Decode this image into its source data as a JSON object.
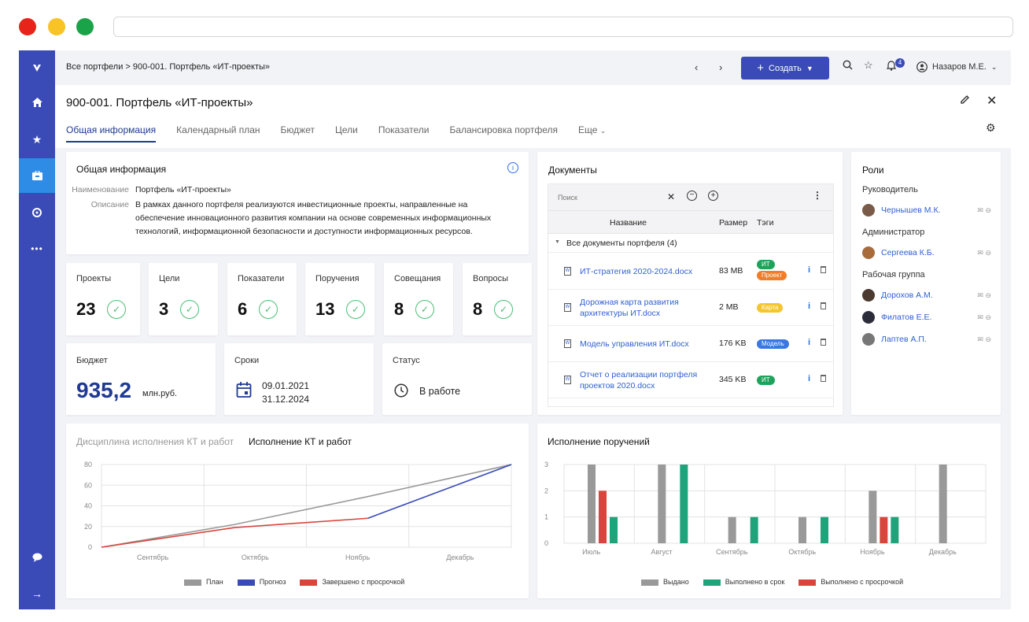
{
  "breadcrumb": "Все портфели > 900-001. Портфель «ИТ-проекты»",
  "toolbar": {
    "create_label": "Создать",
    "notifications_count": "4",
    "user_name": "Назаров М.Е."
  },
  "page": {
    "title": "900-001. Портфель «ИТ-проекты»"
  },
  "tabs": [
    {
      "label": "Общая информация",
      "active": true
    },
    {
      "label": "Календарный план"
    },
    {
      "label": "Бюджет"
    },
    {
      "label": "Цели"
    },
    {
      "label": "Показатели"
    },
    {
      "label": "Балансировка портфеля"
    },
    {
      "label": "Еще"
    }
  ],
  "general_info": {
    "title": "Общая информация",
    "name_key": "Наименование",
    "name_val": "Портфель «ИТ-проекты»",
    "desc_key": "Описание",
    "desc_val": "В рамках данного портфеля реализуются инвестиционные проекты, направленные на обеспечение инновационного развития компании на основе современных информационных технологий, информационной безопасности и доступности информационных ресурсов."
  },
  "stats": [
    {
      "label": "Проекты",
      "value": "23"
    },
    {
      "label": "Цели",
      "value": "3"
    },
    {
      "label": "Показатели",
      "value": "6"
    },
    {
      "label": "Поручения",
      "value": "13"
    },
    {
      "label": "Совещания",
      "value": "8"
    },
    {
      "label": "Вопросы",
      "value": "8"
    }
  ],
  "budget": {
    "label": "Бюджет",
    "value": "935,2",
    "unit": "млн.руб."
  },
  "terms": {
    "label": "Сроки",
    "start": "09.01.2021",
    "end": "31.12.2024"
  },
  "status": {
    "label": "Статус",
    "value": "В работе"
  },
  "documents": {
    "title": "Документы",
    "search_placeholder": "Поиск",
    "col_name": "Название",
    "col_size": "Размер",
    "col_tags": "Тэги",
    "group_label": "Все документы портфеля (4)",
    "rows": [
      {
        "name": "ИТ-стратегия 2020-2024.docx",
        "size": "83 MB",
        "tags": [
          "ИТ",
          "Проект"
        ]
      },
      {
        "name": "Дорожная карта развития архитектуры ИТ.docx",
        "size": "2 MB",
        "tags": [
          "Карта"
        ]
      },
      {
        "name": "Модель управления ИТ.docx",
        "size": "176 KB",
        "tags": [
          "Модель"
        ]
      },
      {
        "name": "Отчет о реализации портфеля проектов 2020.docx",
        "size": "345 KB",
        "tags": [
          "ИТ"
        ]
      }
    ],
    "tag_colors": {
      "ИТ": "#1fa35c",
      "Проект": "#f07d2a",
      "Карта": "#f5c530",
      "Модель": "#3a78e0"
    }
  },
  "roles": {
    "title": "Роли",
    "groups": [
      {
        "name": "Руководитель",
        "people": [
          "Чернышев М.К."
        ]
      },
      {
        "name": "Администратор",
        "people": [
          "Сергеева К.Б."
        ]
      },
      {
        "name": "Рабочая группа",
        "people": [
          "Дорохов А.М.",
          "Филатов Е.Е.",
          "Лаптев А.П."
        ]
      }
    ]
  },
  "chart_line": {
    "tab_inactive": "Дисциплина исполнения КТ и работ",
    "tab_active": "Исполнение КТ и работ",
    "legend": [
      "План",
      "Прогноз",
      "Завершено с просрочкой"
    ]
  },
  "chart_bar": {
    "title": "Исполнение поручений",
    "legend": [
      "Выдано",
      "Выполнено в срок",
      "Выполнено с просрочкой"
    ]
  },
  "chart_data": [
    {
      "type": "line",
      "categories": [
        "Сентябрь",
        "Октябрь",
        "Ноябрь",
        "Декабрь"
      ],
      "ylim": [
        0,
        80
      ],
      "yticks": [
        0,
        20,
        40,
        60,
        80
      ],
      "x": [
        0,
        1.3,
        2.6,
        3.3,
        4
      ],
      "series": [
        {
          "name": "План",
          "color": "#999999",
          "points": [
            [
              0,
              0
            ],
            [
              1.3,
              22
            ],
            [
              2.6,
              49
            ],
            [
              4,
              80
            ]
          ]
        },
        {
          "name": "Прогноз",
          "color": "#3a4bb8",
          "points": [
            [
              2.6,
              28
            ],
            [
              4,
              80
            ]
          ]
        },
        {
          "name": "Завершено с просрочкой",
          "color": "#d9453d",
          "points": [
            [
              0,
              0
            ],
            [
              1.3,
              19
            ],
            [
              2.6,
              28
            ]
          ]
        }
      ]
    },
    {
      "type": "bar",
      "categories": [
        "Июль",
        "Август",
        "Сентябрь",
        "Октябрь",
        "Ноябрь",
        "Декабрь"
      ],
      "ylim": [
        0,
        3
      ],
      "yticks": [
        0,
        1,
        2,
        3
      ],
      "series": [
        {
          "name": "Выдано",
          "color": "#999999",
          "values": [
            3,
            3,
            1,
            1,
            2,
            3
          ]
        },
        {
          "name": "Выполнено с просрочкой",
          "color": "#d9453d",
          "values": [
            2,
            0,
            0,
            0,
            1,
            0
          ]
        },
        {
          "name": "Выполнено в срок",
          "color": "#1fa37a",
          "values": [
            1,
            3,
            1,
            1,
            1,
            0
          ]
        }
      ]
    }
  ]
}
